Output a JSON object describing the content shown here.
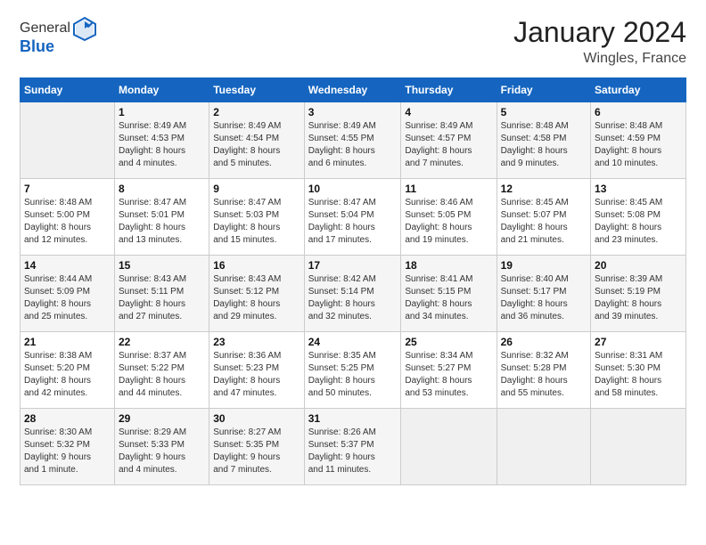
{
  "header": {
    "logo_line1": "General",
    "logo_line2": "Blue",
    "month_year": "January 2024",
    "location": "Wingles, France"
  },
  "weekdays": [
    "Sunday",
    "Monday",
    "Tuesday",
    "Wednesday",
    "Thursday",
    "Friday",
    "Saturday"
  ],
  "weeks": [
    [
      {
        "day": "",
        "detail": ""
      },
      {
        "day": "1",
        "detail": "Sunrise: 8:49 AM\nSunset: 4:53 PM\nDaylight: 8 hours\nand 4 minutes."
      },
      {
        "day": "2",
        "detail": "Sunrise: 8:49 AM\nSunset: 4:54 PM\nDaylight: 8 hours\nand 5 minutes."
      },
      {
        "day": "3",
        "detail": "Sunrise: 8:49 AM\nSunset: 4:55 PM\nDaylight: 8 hours\nand 6 minutes."
      },
      {
        "day": "4",
        "detail": "Sunrise: 8:49 AM\nSunset: 4:57 PM\nDaylight: 8 hours\nand 7 minutes."
      },
      {
        "day": "5",
        "detail": "Sunrise: 8:48 AM\nSunset: 4:58 PM\nDaylight: 8 hours\nand 9 minutes."
      },
      {
        "day": "6",
        "detail": "Sunrise: 8:48 AM\nSunset: 4:59 PM\nDaylight: 8 hours\nand 10 minutes."
      }
    ],
    [
      {
        "day": "7",
        "detail": "Sunrise: 8:48 AM\nSunset: 5:00 PM\nDaylight: 8 hours\nand 12 minutes."
      },
      {
        "day": "8",
        "detail": "Sunrise: 8:47 AM\nSunset: 5:01 PM\nDaylight: 8 hours\nand 13 minutes."
      },
      {
        "day": "9",
        "detail": "Sunrise: 8:47 AM\nSunset: 5:03 PM\nDaylight: 8 hours\nand 15 minutes."
      },
      {
        "day": "10",
        "detail": "Sunrise: 8:47 AM\nSunset: 5:04 PM\nDaylight: 8 hours\nand 17 minutes."
      },
      {
        "day": "11",
        "detail": "Sunrise: 8:46 AM\nSunset: 5:05 PM\nDaylight: 8 hours\nand 19 minutes."
      },
      {
        "day": "12",
        "detail": "Sunrise: 8:45 AM\nSunset: 5:07 PM\nDaylight: 8 hours\nand 21 minutes."
      },
      {
        "day": "13",
        "detail": "Sunrise: 8:45 AM\nSunset: 5:08 PM\nDaylight: 8 hours\nand 23 minutes."
      }
    ],
    [
      {
        "day": "14",
        "detail": "Sunrise: 8:44 AM\nSunset: 5:09 PM\nDaylight: 8 hours\nand 25 minutes."
      },
      {
        "day": "15",
        "detail": "Sunrise: 8:43 AM\nSunset: 5:11 PM\nDaylight: 8 hours\nand 27 minutes."
      },
      {
        "day": "16",
        "detail": "Sunrise: 8:43 AM\nSunset: 5:12 PM\nDaylight: 8 hours\nand 29 minutes."
      },
      {
        "day": "17",
        "detail": "Sunrise: 8:42 AM\nSunset: 5:14 PM\nDaylight: 8 hours\nand 32 minutes."
      },
      {
        "day": "18",
        "detail": "Sunrise: 8:41 AM\nSunset: 5:15 PM\nDaylight: 8 hours\nand 34 minutes."
      },
      {
        "day": "19",
        "detail": "Sunrise: 8:40 AM\nSunset: 5:17 PM\nDaylight: 8 hours\nand 36 minutes."
      },
      {
        "day": "20",
        "detail": "Sunrise: 8:39 AM\nSunset: 5:19 PM\nDaylight: 8 hours\nand 39 minutes."
      }
    ],
    [
      {
        "day": "21",
        "detail": "Sunrise: 8:38 AM\nSunset: 5:20 PM\nDaylight: 8 hours\nand 42 minutes."
      },
      {
        "day": "22",
        "detail": "Sunrise: 8:37 AM\nSunset: 5:22 PM\nDaylight: 8 hours\nand 44 minutes."
      },
      {
        "day": "23",
        "detail": "Sunrise: 8:36 AM\nSunset: 5:23 PM\nDaylight: 8 hours\nand 47 minutes."
      },
      {
        "day": "24",
        "detail": "Sunrise: 8:35 AM\nSunset: 5:25 PM\nDaylight: 8 hours\nand 50 minutes."
      },
      {
        "day": "25",
        "detail": "Sunrise: 8:34 AM\nSunset: 5:27 PM\nDaylight: 8 hours\nand 53 minutes."
      },
      {
        "day": "26",
        "detail": "Sunrise: 8:32 AM\nSunset: 5:28 PM\nDaylight: 8 hours\nand 55 minutes."
      },
      {
        "day": "27",
        "detail": "Sunrise: 8:31 AM\nSunset: 5:30 PM\nDaylight: 8 hours\nand 58 minutes."
      }
    ],
    [
      {
        "day": "28",
        "detail": "Sunrise: 8:30 AM\nSunset: 5:32 PM\nDaylight: 9 hours\nand 1 minute."
      },
      {
        "day": "29",
        "detail": "Sunrise: 8:29 AM\nSunset: 5:33 PM\nDaylight: 9 hours\nand 4 minutes."
      },
      {
        "day": "30",
        "detail": "Sunrise: 8:27 AM\nSunset: 5:35 PM\nDaylight: 9 hours\nand 7 minutes."
      },
      {
        "day": "31",
        "detail": "Sunrise: 8:26 AM\nSunset: 5:37 PM\nDaylight: 9 hours\nand 11 minutes."
      },
      {
        "day": "",
        "detail": ""
      },
      {
        "day": "",
        "detail": ""
      },
      {
        "day": "",
        "detail": ""
      }
    ]
  ]
}
